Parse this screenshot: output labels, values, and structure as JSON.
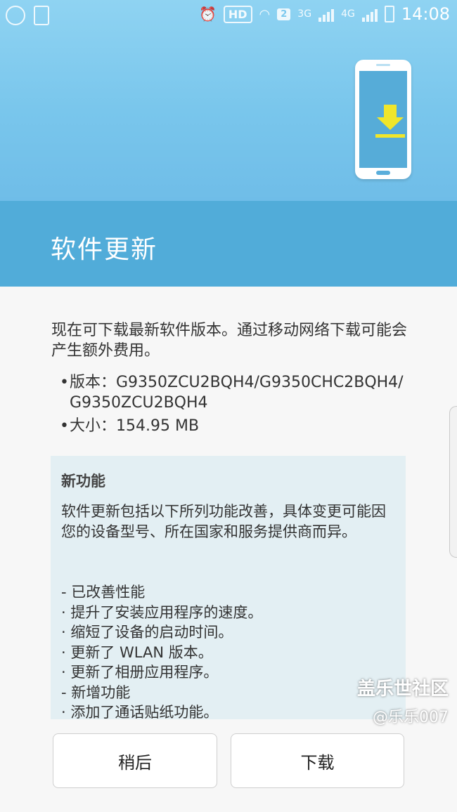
{
  "statusbar": {
    "hd": "HD",
    "sim_badge": "2",
    "net1": "3G",
    "net2": "4G",
    "time": "14:08"
  },
  "header": {
    "title": "软件更新",
    "illustration_icon": "phone-download-icon",
    "accent": "#51acd9"
  },
  "main": {
    "description": "现在可下载最新软件版本。通过移动网络下载可能会产生额外费用。",
    "version_line": "版本：G9350ZCU2BQH4/G9350CHC2BQH4/ G9350ZCU2BQH4",
    "size_line": "大小：154.95 MB",
    "bullet": "•",
    "new_features": {
      "title": "新功能",
      "intro": "软件更新包括以下所列功能改善，具体变更可能因您的设备型号、所在国家和服务提供商而异。",
      "items": [
        "- 已改善性能",
        "· 提升了安装应用程序的速度。",
        "· 缩短了设备的启动时间。",
        "· 更新了 WLAN 版本。",
        "· 更新了相册应用程序。",
        "- 新增功能",
        "· 添加了通话贴纸功能。"
      ]
    }
  },
  "buttons": {
    "later": "稍后",
    "download": "下载"
  },
  "watermark": {
    "title": "盖乐世社区",
    "user": "@乐乐007"
  }
}
